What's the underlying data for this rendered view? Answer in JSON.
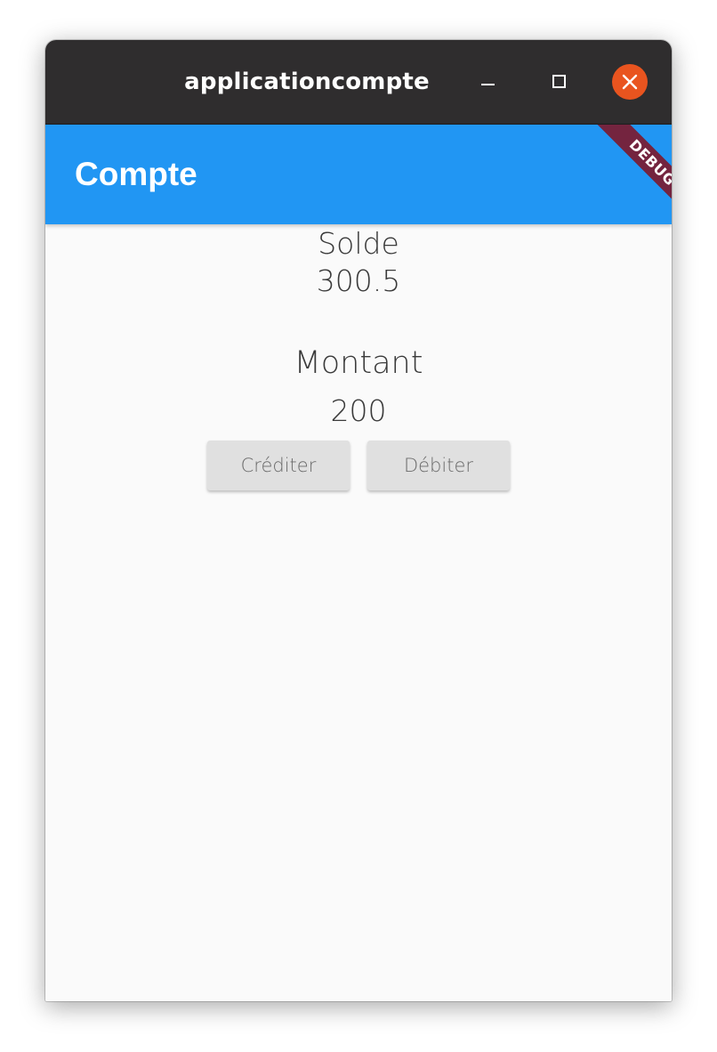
{
  "window": {
    "title": "applicationcompte"
  },
  "titlebar_buttons": {
    "minimize_icon": "minimize-icon",
    "maximize_icon": "maximize-icon",
    "close_icon": "close-icon",
    "close_color": "#e9541f"
  },
  "appbar": {
    "title": "Compte",
    "color": "#2196f3"
  },
  "debug_banner": {
    "label": "DEBUG",
    "color": "#74243f"
  },
  "main": {
    "solde_label": "Solde",
    "solde_value": "300.5",
    "montant_label": "Montant",
    "montant_value": "200",
    "credit_button_label": "Créditer",
    "debit_button_label": "Débiter"
  }
}
